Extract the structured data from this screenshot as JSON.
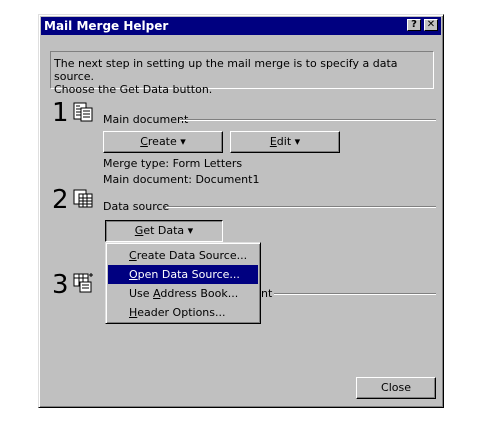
{
  "window": {
    "title": "Mail Merge Helper",
    "help_glyph": "?",
    "close_glyph": "✕"
  },
  "info": {
    "line1": "The next step in setting up the mail merge is to specify a data source.",
    "line2": "Choose the Get Data button."
  },
  "step1": {
    "number": "1",
    "icon": "main-document-icon",
    "group_label": "Main document",
    "create": {
      "label": "Create",
      "accel": "C",
      "arrow": "▾"
    },
    "edit": {
      "label": "Edit",
      "accel": "E",
      "arrow": "▾"
    },
    "merge_type": "Merge type: Form Letters",
    "main_document": "Main document: Document1"
  },
  "step2": {
    "number": "2",
    "icon": "data-source-icon",
    "group_label": "Data source",
    "get_data": {
      "label": "Get Data",
      "accel": "G",
      "arrow": "▾"
    }
  },
  "step3": {
    "number": "3",
    "icon": "merge-data-icon",
    "group_label_partial": "nt"
  },
  "menu": {
    "items": [
      {
        "accel": "C",
        "rest": "reate Data Source...",
        "selected": false
      },
      {
        "accel": "O",
        "rest": "pen Data Source...",
        "selected": true
      },
      {
        "pre": "Use ",
        "accel": "A",
        "rest": "ddress Book...",
        "selected": false
      },
      {
        "accel": "H",
        "rest": "eader Options...",
        "selected": false
      }
    ]
  },
  "footer": {
    "close_label": "Close"
  }
}
